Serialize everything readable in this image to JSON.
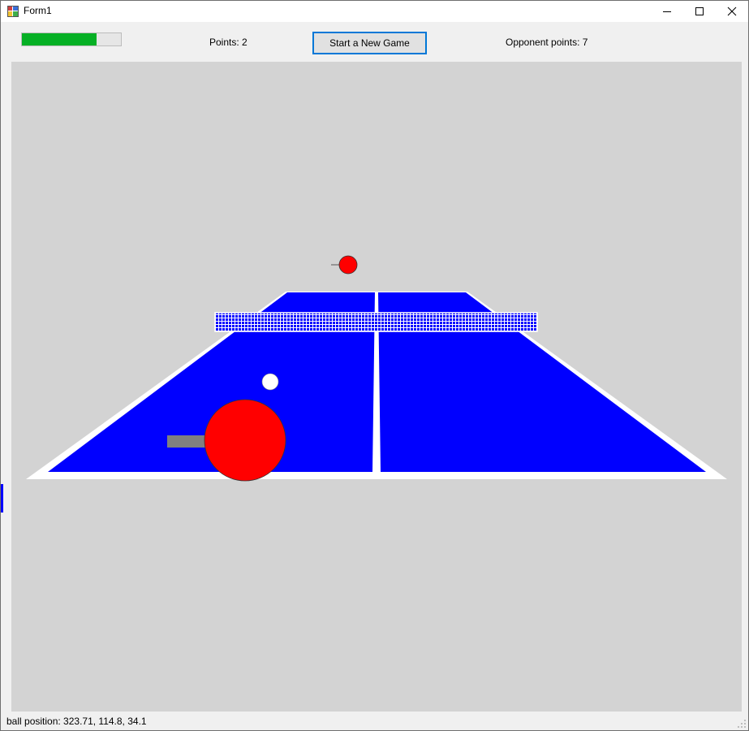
{
  "window": {
    "title": "Form1",
    "icons": {
      "app": "app-form-icon",
      "minimize": "minimize-icon",
      "maximize": "maximize-icon",
      "close": "close-icon"
    }
  },
  "toolbar": {
    "progress_fraction": 0.75,
    "progress_color": "#06b025",
    "points_label": "Points: 2",
    "new_game_label": "Start a New Game",
    "opponent_label": "Opponent points: 7"
  },
  "game": {
    "background_color": "#d3d3d3",
    "table_color": "#0000ff",
    "line_color": "#ffffff",
    "net_color": "#0000ff",
    "ball_color": "#ffffff",
    "player_paddle_color": "#ff0000",
    "opponent_paddle_color": "#ff0000",
    "handle_color": "#808080"
  },
  "status": {
    "ball_position": "ball position: 323.71, 114.8, 34.1"
  }
}
